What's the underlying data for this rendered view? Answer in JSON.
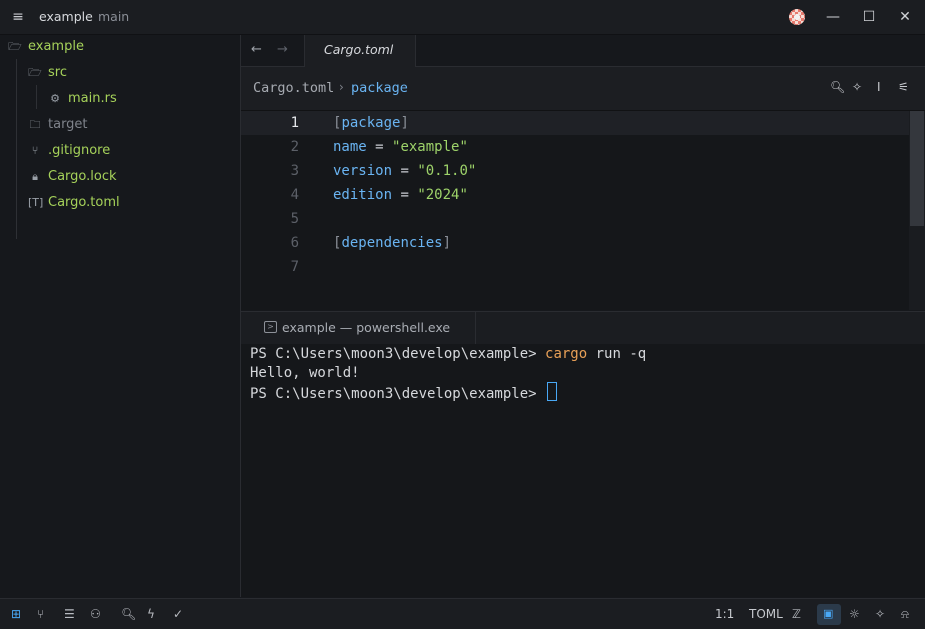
{
  "titlebar": {
    "project": "example",
    "branch": "main",
    "menu_icon": "hamburger-menu-icon",
    "minimize_glyph": "—",
    "maximize_glyph": "☐",
    "close_glyph": "✕"
  },
  "sidebar": {
    "items": [
      {
        "label": "example",
        "icon": "folder-open-icon",
        "color": "#a6d25a"
      },
      {
        "label": "src",
        "icon": "folder-open-icon",
        "color": "#a6d25a"
      },
      {
        "label": "main.rs",
        "icon": "rust-file-icon",
        "color": "#a6d25a"
      },
      {
        "label": "target",
        "icon": "folder-icon",
        "color": "#7f838b"
      },
      {
        "label": ".gitignore",
        "icon": "git-branch-icon",
        "color": "#a6d25a"
      },
      {
        "label": "Cargo.lock",
        "icon": "lock-icon",
        "color": "#a6d25a"
      },
      {
        "label": "Cargo.toml",
        "icon": "toml-file-icon",
        "color": "#a6d25a"
      }
    ]
  },
  "editor": {
    "tab_label": "Cargo.toml",
    "breadcrumb_file": "Cargo.toml",
    "breadcrumb_separator": "›",
    "breadcrumb_symbol": "package",
    "lines": [
      {
        "n": "1",
        "parts": [
          [
            "br",
            "["
          ],
          [
            "key",
            "package"
          ],
          [
            "br",
            "]"
          ]
        ]
      },
      {
        "n": "2",
        "parts": [
          [
            "key",
            "name"
          ],
          [
            "op",
            " = "
          ],
          [
            "str",
            "\"example\""
          ]
        ]
      },
      {
        "n": "3",
        "parts": [
          [
            "key",
            "version"
          ],
          [
            "op",
            " = "
          ],
          [
            "str",
            "\"0.1.0\""
          ]
        ]
      },
      {
        "n": "4",
        "parts": [
          [
            "key",
            "edition"
          ],
          [
            "op",
            " = "
          ],
          [
            "str",
            "\"2024\""
          ]
        ]
      },
      {
        "n": "5",
        "parts": []
      },
      {
        "n": "6",
        "parts": [
          [
            "br",
            "["
          ],
          [
            "key",
            "dependencies"
          ],
          [
            "br",
            "]"
          ]
        ]
      },
      {
        "n": "7",
        "parts": []
      }
    ]
  },
  "terminal": {
    "tab_label": "example — powershell.exe",
    "line1_prompt": "PS C:\\Users\\moon3\\develop\\example> ",
    "line1_cmd": "cargo",
    "line1_args": " run -q",
    "line2": "Hello, world!",
    "line3_prompt": "PS C:\\Users\\moon3\\develop\\example> "
  },
  "statusbar": {
    "cursor_position": "1:1",
    "language": "TOML"
  },
  "colors": {
    "accent": "#49a8f5",
    "tree_active": "#a6d25a",
    "string": "#9ed36a",
    "keyword": "#6ab4f2",
    "command": "#e8a057"
  }
}
